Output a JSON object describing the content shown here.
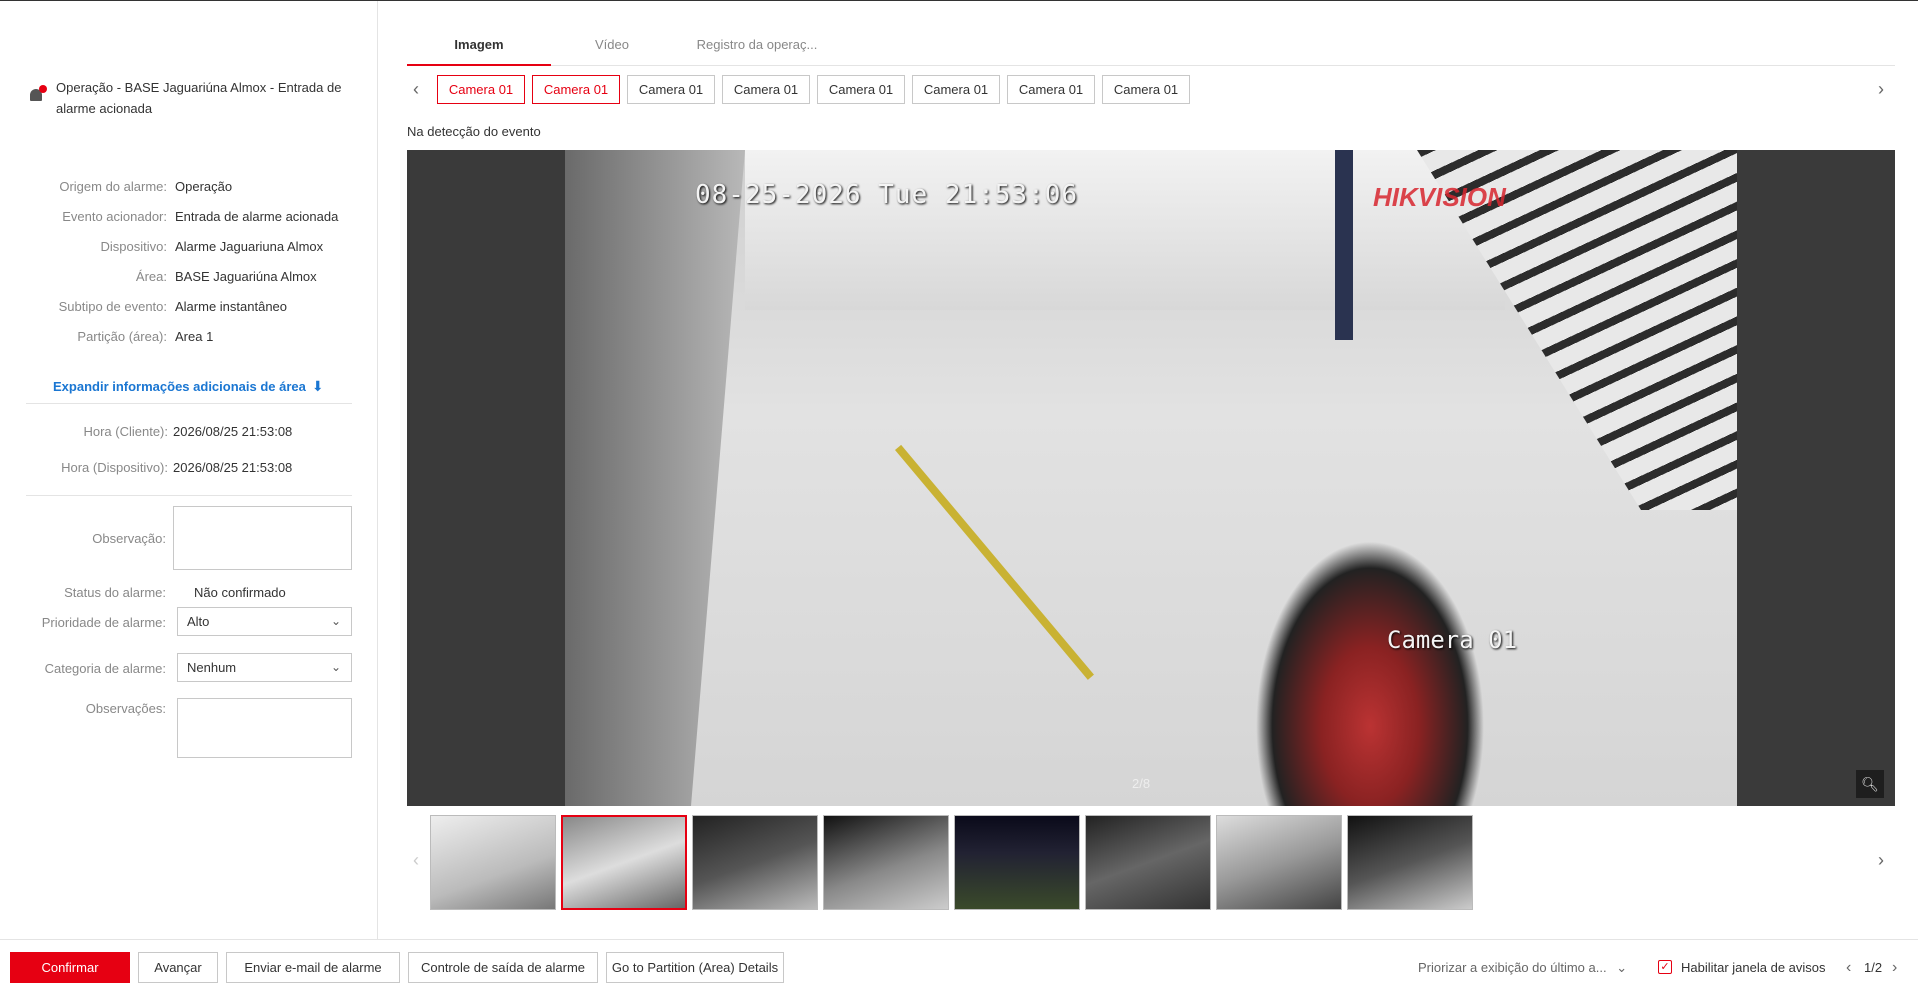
{
  "alarm": {
    "title": "Operação - BASE Jaguariúna Almox - Entrada de alarme acionada"
  },
  "details": [
    {
      "label": "Origem do alarme:",
      "value": "Operação"
    },
    {
      "label": "Evento acionador:",
      "value": "Entrada de alarme acionada"
    },
    {
      "label": "Dispositivo:",
      "value": "Alarme Jaguariuna Almox"
    },
    {
      "label": "Área:",
      "value": "BASE Jaguariúna Almox"
    },
    {
      "label": "Subtipo de evento:",
      "value": "Alarme instantâneo"
    },
    {
      "label": "Partição (área):",
      "value": "Area 1"
    }
  ],
  "expand_label": "Expandir informações adicionais de área",
  "times": [
    {
      "label": "Hora (Cliente):",
      "value": "2026/08/25 21:53:08"
    },
    {
      "label": "Hora (Dispositivo):",
      "value": "2026/08/25 21:53:08"
    }
  ],
  "form": {
    "observacao_label": "Observação:",
    "status_label": "Status do alarme:",
    "status_value": "Não confirmado",
    "prioridade_label": "Prioridade de alarme:",
    "prioridade_value": "Alto",
    "categoria_label": "Categoria de alarme:",
    "categoria_value": "Nenhum",
    "observacoes_label": "Observações:"
  },
  "tabs": [
    "Imagem",
    "Vídeo",
    "Registro da operaç..."
  ],
  "cameras": [
    "Camera 01",
    "Camera 01",
    "Camera 01",
    "Camera 01",
    "Camera 01",
    "Camera 01",
    "Camera 01",
    "Camera 01"
  ],
  "event_label": "Na detecção do evento",
  "viewer": {
    "osd_time": "08-25-2026 Tue 21:53:06",
    "osd_brand": "HIKVISION",
    "osd_camera": "Camera 01",
    "counter": "2/8"
  },
  "buttons": {
    "confirmar": "Confirmar",
    "avancar": "Avançar",
    "email": "Enviar e-mail de alarme",
    "saida": "Controle de saída de alarme",
    "partition": "Go to Partition (Area) Details"
  },
  "bottom_right": {
    "priorizar": "Priorizar a exibição do último a...",
    "habilitar": "Habilitar janela de avisos",
    "page": "1/2"
  },
  "colors": {
    "accent": "#e60012",
    "link": "#1a76d2"
  },
  "icons": {
    "alarm": "alarm-siren-icon",
    "expand": "double-chevron-down-icon",
    "zoom": "zoom-in-icon"
  }
}
